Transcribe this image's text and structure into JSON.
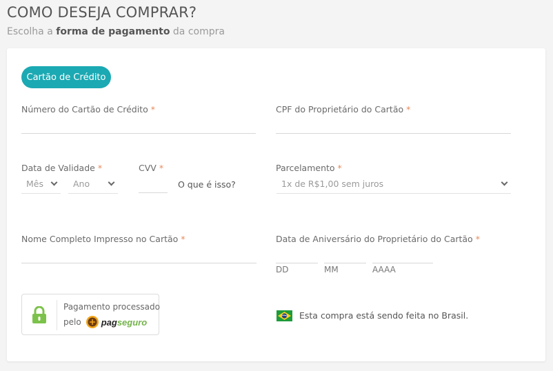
{
  "header": {
    "title": "COMO DESEJA COMPRAR?",
    "subtitle_pre": "Escolha a ",
    "subtitle_bold": "forma de pagamento",
    "subtitle_post": " da compra"
  },
  "payment_tab": {
    "label": "Cartão de Crédito"
  },
  "required_mark": "*",
  "form": {
    "card_number": {
      "label": "Número do Cartão de Crédito",
      "value": ""
    },
    "cpf": {
      "label": "CPF do Proprietário do Cartão",
      "value": ""
    },
    "expiry": {
      "label": "Data de Validade",
      "month_selected": "Mês",
      "year_selected": "Ano"
    },
    "cvv": {
      "label": "CVV",
      "value": "",
      "help_link": "O que é isso?"
    },
    "installments": {
      "label": "Parcelamento",
      "selected": "1x de R$1,00 sem juros"
    },
    "name": {
      "label": "Nome Completo Impresso no Cartão",
      "value": ""
    },
    "birthday": {
      "label": "Data de Aniversário do Proprietário do Cartão",
      "day_placeholder": "DD",
      "month_placeholder": "MM",
      "year_placeholder": "AAAA"
    }
  },
  "pagseguro": {
    "line1": "Pagamento processado",
    "line2": "pelo",
    "logo_pag": "pag",
    "logo_seguro": "seguro"
  },
  "country": {
    "text": "Esta compra está sendo feita no Brasil.",
    "flag": "brazil-flag"
  },
  "colors": {
    "accent": "#1ba9b3",
    "required": "#e8895a",
    "lock": "#7cc24a",
    "pagseguro_green": "#74b34b"
  }
}
